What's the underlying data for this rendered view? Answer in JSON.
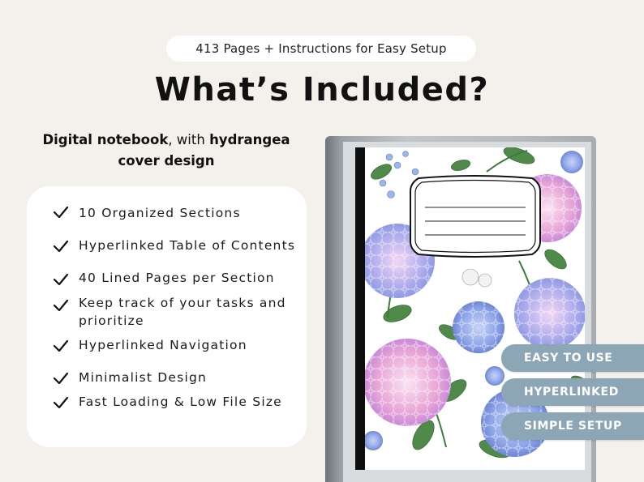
{
  "top_badge": "413 Pages + Instructions for Easy Setup",
  "headline": "What’s Included?",
  "subtitle": {
    "bold_1": "Digital notebook",
    "text_1": ", with ",
    "bold_2": "hydrangea",
    "bold_3": "cover design"
  },
  "features": [
    "10 Organized Sections",
    "Hyperlinked Table of Contents",
    "40 Lined Pages per Section",
    "Keep track of your tasks and prioritize",
    "Hyperlinked Navigation",
    "Minimalist Design",
    "Fast Loading & Low File Size"
  ],
  "tags": [
    "EASY TO USE",
    "HYPERLINKED",
    "SIMPLE SETUP"
  ],
  "colors": {
    "background": "#f4f1ec",
    "tag": "#8ca6b6",
    "flower_blue": "#8ea6e8",
    "flower_pink": "#e7a6d6",
    "leaf": "#4f8a4a"
  }
}
